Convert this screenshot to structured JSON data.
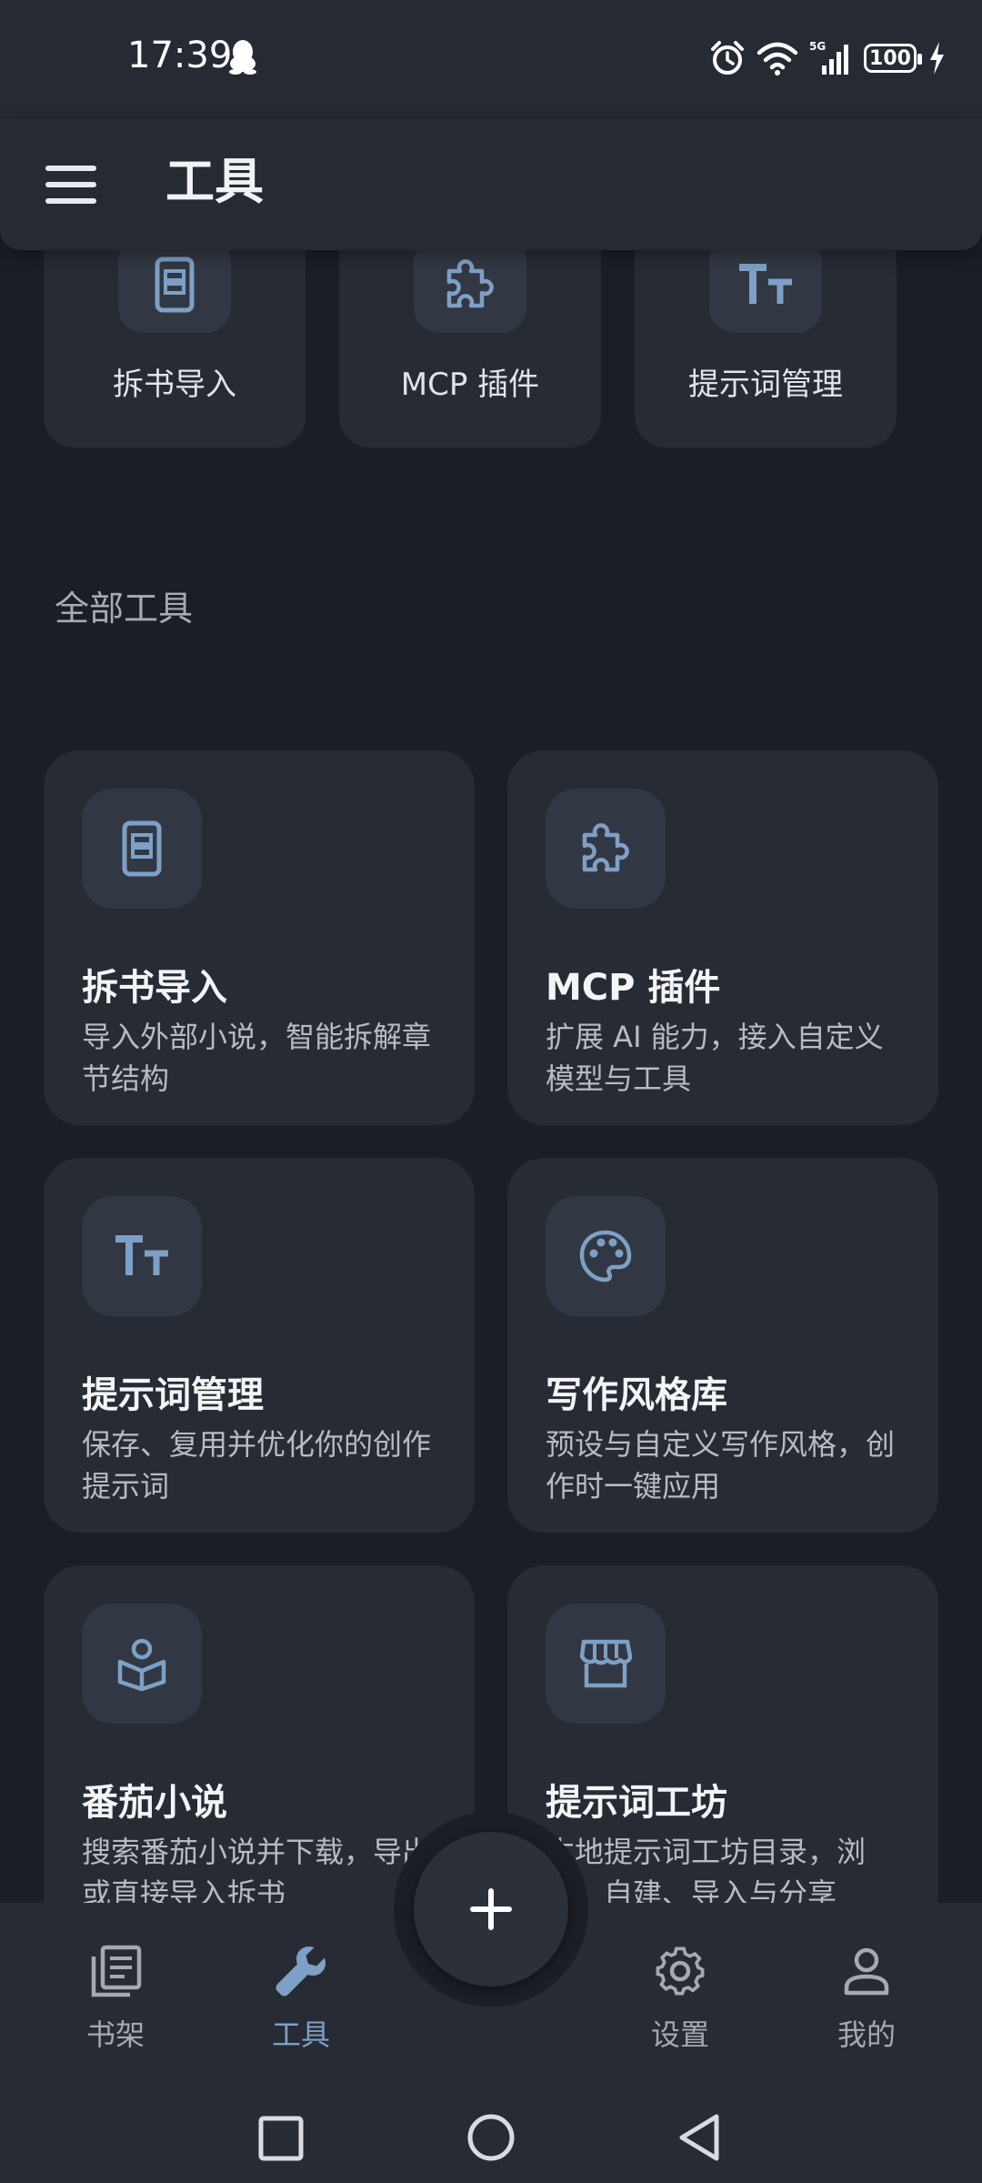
{
  "status_bar": {
    "time": "17:39",
    "battery": "100",
    "network": "5G"
  },
  "header": {
    "title": "工具"
  },
  "quick_tools": [
    {
      "label": "拆书导入",
      "icon": "phone-book-icon"
    },
    {
      "label": "MCP 插件",
      "icon": "puzzle-icon"
    },
    {
      "label": "提示词管理",
      "icon": "text-size-icon"
    }
  ],
  "section_title": "全部工具",
  "tools": [
    {
      "title": "拆书导入",
      "desc": "导入外部小说，智能拆解章节结构",
      "icon": "phone-book-icon"
    },
    {
      "title": "MCP 插件",
      "desc": "扩展 AI 能力，接入自定义模型与工具",
      "icon": "puzzle-icon"
    },
    {
      "title": "提示词管理",
      "desc": "保存、复用并优化你的创作提示词",
      "icon": "text-size-icon"
    },
    {
      "title": "写作风格库",
      "desc": "预设与自定义写作风格，创作时一键应用",
      "icon": "palette-icon"
    },
    {
      "title": "番茄小说",
      "desc": "搜索番茄小说并下载，导出或直接导入拆书",
      "icon": "reading-icon"
    },
    {
      "title": "提示词工坊",
      "desc": "本地提示词工坊目录，浏览、自建、导入与分享",
      "icon": "store-icon"
    }
  ],
  "bottom_nav": [
    {
      "label": "书架",
      "icon": "bookshelf-icon",
      "active": false
    },
    {
      "label": "工具",
      "icon": "wrench-icon",
      "active": true
    },
    {
      "label": "设置",
      "icon": "gear-icon",
      "active": false
    },
    {
      "label": "我的",
      "icon": "person-icon",
      "active": false
    }
  ],
  "colors": {
    "accent": "#7ea0c6",
    "background": "#1b1e25",
    "card": "#272b34"
  }
}
